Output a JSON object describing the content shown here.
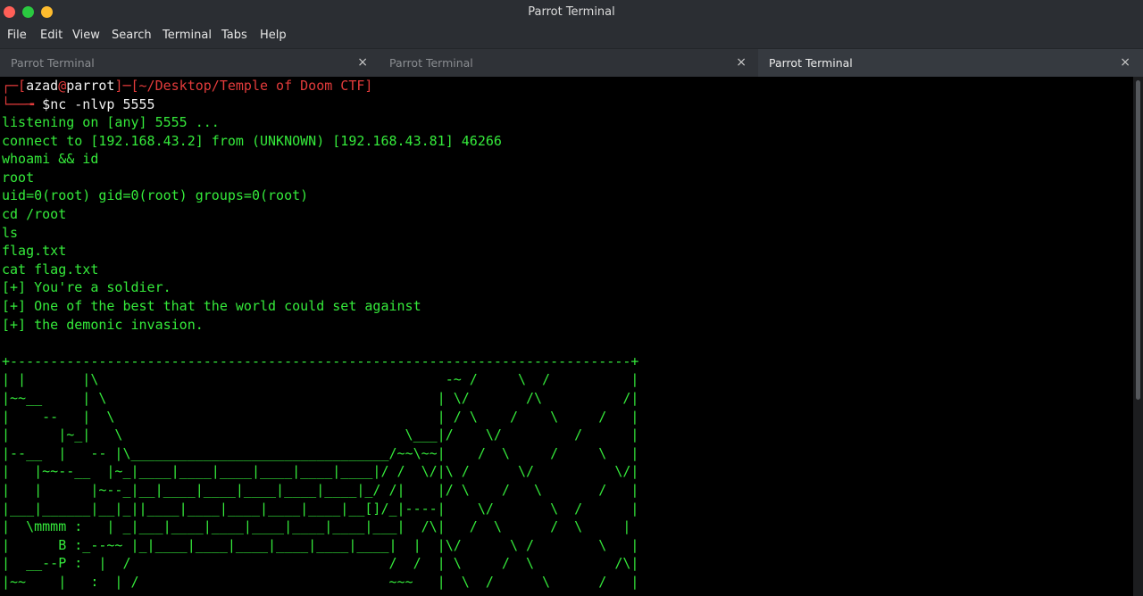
{
  "window": {
    "title": "Parrot Terminal"
  },
  "menu": [
    "File",
    "Edit",
    "View",
    "Search",
    "Terminal",
    "Tabs",
    "Help"
  ],
  "tabs": [
    {
      "label": "Parrot Terminal",
      "close": "×"
    },
    {
      "label": "Parrot Terminal",
      "close": "×"
    },
    {
      "label": "Parrot Terminal",
      "close": "×"
    }
  ],
  "prompt": {
    "user": "azad",
    "at": "@",
    "host": "parrot",
    "path": "~/Desktop/Temple of Doom CTF",
    "symbol": "$",
    "command": "nc -nlvp 5555"
  },
  "output": [
    "listening on [any] 5555 ...",
    "connect to [192.168.43.2] from (UNKNOWN) [192.168.43.81] 46266",
    "whoami && id",
    "root",
    "uid=0(root) gid=0(root) groups=0(root)",
    "cd /root",
    "ls",
    "flag.txt",
    "cat flag.txt",
    "[+] You're a soldier.",
    "[+] One of the best that the world could set against",
    "[+] the demonic invasion.",
    "",
    "+-----------------------------------------------------------------------------+",
    "| |       |\\                                           -~ /     \\  /          |",
    "|~~__     | \\                                         | \\/       /\\          /|",
    "|    --   |  \\                                        | / \\    /    \\     /   |",
    "|      |~_|   \\                                   \\___|/    \\/         /      |",
    "|--__  |   -- |\\________________________________/~~\\~~|    /  \\     /     \\   |",
    "|   |~~--__  |~_|____|____|____|____|____|____|/ /  \\/|\\ /      \\/          \\/|",
    "|   |      |~--_|__|____|____|____|____|____|_/ /|    |/ \\    /   \\       /   |",
    "|___|______|__|_||____|____|____|____|____|__[]/_|----|    \\/       \\  /      |",
    "|  \\mmmm :   | _|___|____|____|____|____|____|___|  /\\|   /  \\      /  \\     |",
    "|      B :_--~~ |_|____|____|____|____|____|____|  |  |\\/      \\ /        \\   |",
    "|  __--P :  |  /                                /  /  | \\     /  \\          /\\|",
    "|~~    |   :  | /                               ~~~   |  \\  /      \\      /   |"
  ]
}
